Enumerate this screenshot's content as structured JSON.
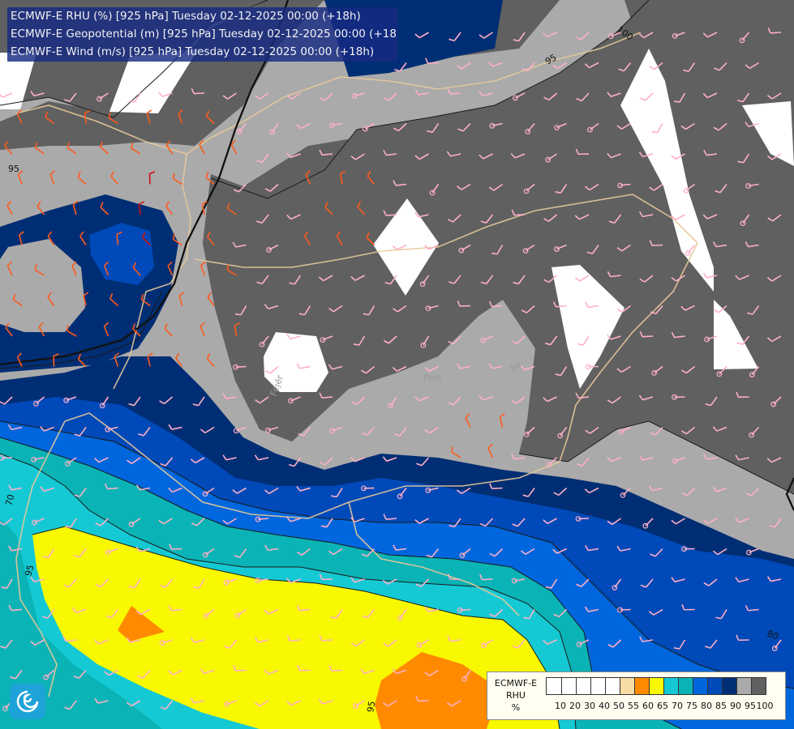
{
  "title_lines": [
    "ECMWF-E RHU (%) [925 hPa] Tuesday 02-12-2025 00:00 (+18h)",
    "ECMWF-E Geopotential (m) [925 hPa] Tuesday 02-12-2025 00:00 (+18h)",
    "ECMWF-E Wind (m/s) [925 hPa] Tuesday 02-12-2025 00:00 (+18h)"
  ],
  "legend": {
    "label": [
      "ECMWF-E",
      "RHU",
      "%"
    ],
    "ticks": [
      "10",
      "20",
      "30",
      "40",
      "50",
      "55",
      "60",
      "65",
      "70",
      "75",
      "80",
      "85",
      "90",
      "95",
      "100"
    ],
    "colors": [
      "#ffffff",
      "#ffffff",
      "#ffffff",
      "#ffffff",
      "#ffffff",
      "#f7dca6",
      "#ff8a00",
      "#f8f800",
      "#15c9d4",
      "#0ab3b5",
      "#0066dd",
      "#0049b8",
      "#002e74",
      "#aaaaaa",
      "#606060"
    ]
  },
  "contour_labels": [
    {
      "text": "95"
    },
    {
      "text": "100"
    },
    {
      "text": "95"
    },
    {
      "text": "70"
    },
    {
      "text": "95"
    },
    {
      "text": "80"
    },
    {
      "text": "95"
    }
  ],
  "place_labels": [
    {
      "text": "Pest"
    },
    {
      "text": "Fejér"
    },
    {
      "text": "Bé"
    }
  ],
  "logo_icon": "ecmwf-logo-icon"
}
